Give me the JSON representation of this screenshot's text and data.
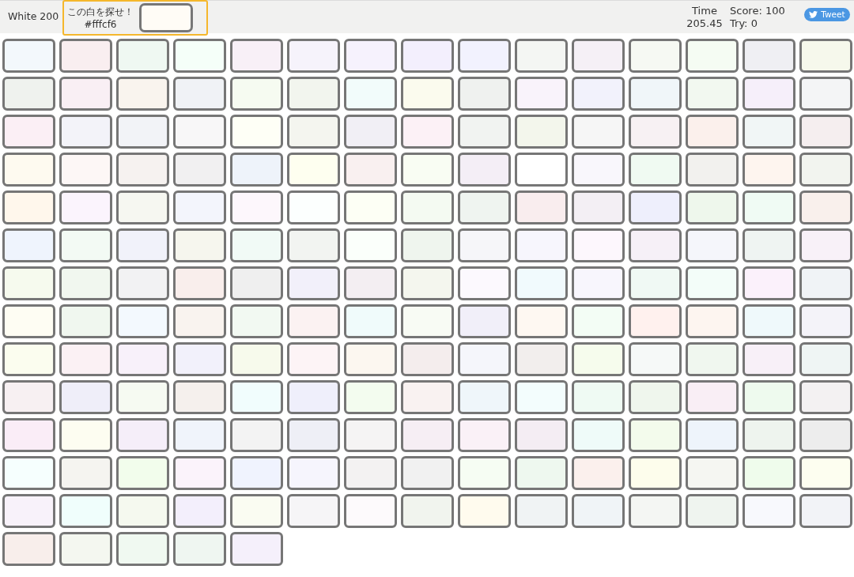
{
  "header": {
    "title": "White 200",
    "target": {
      "prompt": "この白を探せ！",
      "hex": "#fffcf6",
      "color": "#fffcf6"
    },
    "time": {
      "label": "Time",
      "value": "205.45"
    },
    "score": "Score: 100",
    "tries": "Try: 0",
    "tweet_button": "Tweet"
  },
  "tiles": [
    {
      "color": "#f3f8fc"
    },
    {
      "color": "#f9eef0"
    },
    {
      "color": "#eff8f2"
    },
    {
      "color": "#f5fff9"
    },
    {
      "color": "#f8f0f7"
    },
    {
      "color": "#f6f3fb"
    },
    {
      "color": "#f6f2fd"
    },
    {
      "color": "#f3effd"
    },
    {
      "color": "#f2f2fe"
    },
    {
      "color": "#f4f6f3"
    },
    {
      "color": "#f5f0f6"
    },
    {
      "color": "#f6f9f3"
    },
    {
      "color": "#f5fcf3"
    },
    {
      "color": "#efeff3"
    },
    {
      "color": "#f6f8ec"
    },
    {
      "color": "#eff2ee"
    },
    {
      "color": "#f9eff4"
    },
    {
      "color": "#f9f4ee"
    },
    {
      "color": "#f0f2f6"
    },
    {
      "color": "#f6fbf1"
    },
    {
      "color": "#f2f5ee"
    },
    {
      "color": "#f2fcfb"
    },
    {
      "color": "#fbfbee"
    },
    {
      "color": "#eff1ef"
    },
    {
      "color": "#f9f3fb"
    },
    {
      "color": "#f2f2fc"
    },
    {
      "color": "#f0f6f9"
    },
    {
      "color": "#f2f8f0"
    },
    {
      "color": "#f6effa"
    },
    {
      "color": "#f4f5f6"
    },
    {
      "color": "#fbeff5"
    },
    {
      "color": "#f3f3f9"
    },
    {
      "color": "#f2f3f7"
    },
    {
      "color": "#f8f7f8"
    },
    {
      "color": "#fefff6"
    },
    {
      "color": "#f4f5ef"
    },
    {
      "color": "#f1eff5"
    },
    {
      "color": "#fcf1f6"
    },
    {
      "color": "#f1f3f1"
    },
    {
      "color": "#f3f6ec"
    },
    {
      "color": "#f6f6f6"
    },
    {
      "color": "#f7f1f3"
    },
    {
      "color": "#fbf0ec"
    },
    {
      "color": "#f1f6f6"
    },
    {
      "color": "#f5eeef"
    },
    {
      "color": "#fefaf0"
    },
    {
      "color": "#fdf7f6"
    },
    {
      "color": "#f6f2f0"
    },
    {
      "color": "#f1f0f1"
    },
    {
      "color": "#eef3fa"
    },
    {
      "color": "#fefff0"
    },
    {
      "color": "#f9f0f0"
    },
    {
      "color": "#f9fdf3"
    },
    {
      "color": "#f4eef6"
    },
    {
      "color": "#ffffff"
    },
    {
      "color": "#f9f7fc"
    },
    {
      "color": "#f0faf2"
    },
    {
      "color": "#f2f1ee"
    },
    {
      "color": "#fef5ef"
    },
    {
      "color": "#f2f4ef"
    },
    {
      "color": "#fff7ec"
    },
    {
      "color": "#fbf4fd"
    },
    {
      "color": "#f6f7f1"
    },
    {
      "color": "#f3f5fc"
    },
    {
      "color": "#fdf7fc"
    },
    {
      "color": "#fcfffe"
    },
    {
      "color": "#fdfff5"
    },
    {
      "color": "#f4faf2"
    },
    {
      "color": "#eff4f0"
    },
    {
      "color": "#f9edee"
    },
    {
      "color": "#f3eff4"
    },
    {
      "color": "#eeeffc"
    },
    {
      "color": "#eef7ec"
    },
    {
      "color": "#f0fbf4"
    },
    {
      "color": "#f9f0ec"
    },
    {
      "color": "#eff4fd"
    },
    {
      "color": "#f3faf4"
    },
    {
      "color": "#f1f2fa"
    },
    {
      "color": "#f6f6ee"
    },
    {
      "color": "#f1faf6"
    },
    {
      "color": "#f2f4f1"
    },
    {
      "color": "#fbfffb"
    },
    {
      "color": "#eff5ee"
    },
    {
      "color": "#f6f6f9"
    },
    {
      "color": "#f7f6fd"
    },
    {
      "color": "#fdf7fd"
    },
    {
      "color": "#f6f0f7"
    },
    {
      "color": "#f5f6fb"
    },
    {
      "color": "#eff4f2"
    },
    {
      "color": "#f8f1f8"
    },
    {
      "color": "#f6faee"
    },
    {
      "color": "#f1f7ef"
    },
    {
      "color": "#f2f2f3"
    },
    {
      "color": "#f9eeec"
    },
    {
      "color": "#efefef"
    },
    {
      "color": "#f2f0fa"
    },
    {
      "color": "#f3eef2"
    },
    {
      "color": "#f4f6ee"
    },
    {
      "color": "#fcf9fe"
    },
    {
      "color": "#f1fafd"
    },
    {
      "color": "#f8f6fd"
    },
    {
      "color": "#f0f9f4"
    },
    {
      "color": "#f3fdf9"
    },
    {
      "color": "#fbf1fb"
    },
    {
      "color": "#f0f3f6"
    },
    {
      "color": "#fefdf3"
    },
    {
      "color": "#f0f7ef"
    },
    {
      "color": "#f3f9fe"
    },
    {
      "color": "#f9f3ef"
    },
    {
      "color": "#f2f9f2"
    },
    {
      "color": "#fbf2f2"
    },
    {
      "color": "#f0fbfb"
    },
    {
      "color": "#f8fbf4"
    },
    {
      "color": "#f1eff9"
    },
    {
      "color": "#fef8f2"
    },
    {
      "color": "#f3fdf5"
    },
    {
      "color": "#fff1ee"
    },
    {
      "color": "#fdf5f0"
    },
    {
      "color": "#eff9fb"
    },
    {
      "color": "#f4f3f9"
    },
    {
      "color": "#fbfdef"
    },
    {
      "color": "#fbf1f4"
    },
    {
      "color": "#f8f1fa"
    },
    {
      "color": "#f2f1fb"
    },
    {
      "color": "#f7faec"
    },
    {
      "color": "#fdf4f6"
    },
    {
      "color": "#fcf7f0"
    },
    {
      "color": "#f4eded"
    },
    {
      "color": "#f5f6fb"
    },
    {
      "color": "#f2eeed"
    },
    {
      "color": "#f6fced"
    },
    {
      "color": "#f6f9f8"
    },
    {
      "color": "#f0f7ef"
    },
    {
      "color": "#f8f0f8"
    },
    {
      "color": "#eff5f4"
    },
    {
      "color": "#f7f0f2"
    },
    {
      "color": "#efeef9"
    },
    {
      "color": "#f6faf2"
    },
    {
      "color": "#f5f0ed"
    },
    {
      "color": "#f1fdfd"
    },
    {
      "color": "#efeffb"
    },
    {
      "color": "#f3fcef"
    },
    {
      "color": "#f9f2f1"
    },
    {
      "color": "#eff6fa"
    },
    {
      "color": "#f3fdfd"
    },
    {
      "color": "#effaf3"
    },
    {
      "color": "#eff6ed"
    },
    {
      "color": "#f9eef5"
    },
    {
      "color": "#eefaee"
    },
    {
      "color": "#f3f1f2"
    },
    {
      "color": "#faedf7"
    },
    {
      "color": "#fdfdf1"
    },
    {
      "color": "#f5eef9"
    },
    {
      "color": "#f0f4fb"
    },
    {
      "color": "#f3f3f3"
    },
    {
      "color": "#eeeff6"
    },
    {
      "color": "#f5f4f4"
    },
    {
      "color": "#f6eef4"
    },
    {
      "color": "#faf1f7"
    },
    {
      "color": "#f4edf3"
    },
    {
      "color": "#effbf9"
    },
    {
      "color": "#f3fbec"
    },
    {
      "color": "#eef4fb"
    },
    {
      "color": "#eef4ee"
    },
    {
      "color": "#ededed"
    },
    {
      "color": "#f6fffe"
    },
    {
      "color": "#f5f4f0"
    },
    {
      "color": "#f2fdec"
    },
    {
      "color": "#fbf3fb"
    },
    {
      "color": "#f0f3fe"
    },
    {
      "color": "#f6f5fd"
    },
    {
      "color": "#f3f2f2"
    },
    {
      "color": "#f1f1f1"
    },
    {
      "color": "#f6fdf3"
    },
    {
      "color": "#eef8ef"
    },
    {
      "color": "#fbf0ed"
    },
    {
      "color": "#fdfdec"
    },
    {
      "color": "#f5f6f2"
    },
    {
      "color": "#effcec"
    },
    {
      "color": "#fdfef0"
    },
    {
      "color": "#f8f2fa"
    },
    {
      "color": "#f0fefc"
    },
    {
      "color": "#f5f9ef"
    },
    {
      "color": "#f3effc"
    },
    {
      "color": "#fafcf2"
    },
    {
      "color": "#f6f5f7"
    },
    {
      "color": "#fdfafc"
    },
    {
      "color": "#f1f4ee"
    },
    {
      "color": "#fffbee"
    },
    {
      "color": "#f0f3f4"
    },
    {
      "color": "#f0f4f7"
    },
    {
      "color": "#f4f6f3"
    },
    {
      "color": "#eff4ef"
    },
    {
      "color": "#f8f9fd"
    },
    {
      "color": "#f2f3f7"
    },
    {
      "color": "#f8eeeb"
    },
    {
      "color": "#f4f7f0"
    },
    {
      "color": "#f0f9f1"
    },
    {
      "color": "#eff6f1"
    },
    {
      "color": "#f5f0fb"
    }
  ]
}
